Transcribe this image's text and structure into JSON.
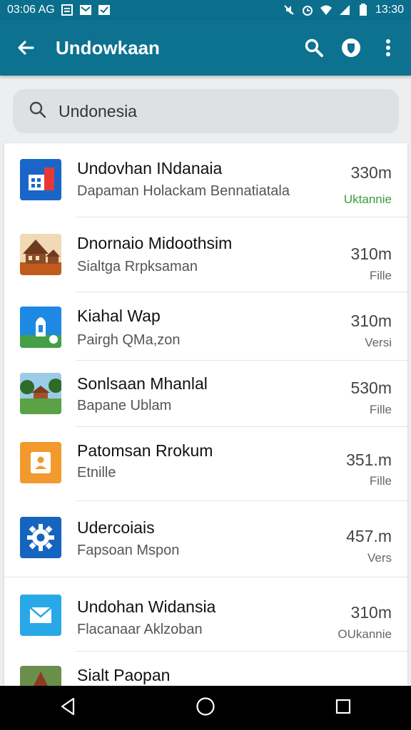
{
  "status_bar": {
    "left_text": "03:06 AG",
    "time": "13:30",
    "icons": [
      "image-icon",
      "mail-icon",
      "check-icon",
      "mute-icon",
      "alarm-icon",
      "wifi-icon",
      "signal-icon",
      "battery-icon"
    ]
  },
  "app_bar": {
    "title": "Undowkaan",
    "icons": [
      "back-arrow-icon",
      "search-icon",
      "shield-icon",
      "more-vert-icon"
    ]
  },
  "search": {
    "value": "Undonesia",
    "icon": "search-icon"
  },
  "list": [
    {
      "title": "Undovhan INdanaia",
      "subtitle": "Dapaman Holackam Bennatiatala",
      "size": "330m",
      "type": "Uktannie",
      "icon": "building-icon",
      "type_color": "#3b9b3b"
    },
    {
      "title": "Dnornaio Midoothsim",
      "subtitle": "Sialtga Rrpksaman",
      "size": "310m",
      "type": "Fille",
      "icon": "house-photo-icon",
      "type_color": "#666666"
    },
    {
      "title": "Kiahal Wap",
      "subtitle": "Pairgh QMa,zon",
      "size": "310m",
      "type": "Versi",
      "icon": "map-pin-icon",
      "type_color": "#666666"
    },
    {
      "title": "Sonlsaan Mhanlal",
      "subtitle": "Bapane Ublam",
      "size": "530m",
      "type": "Fille",
      "icon": "pavilion-photo-icon",
      "type_color": "#666666"
    },
    {
      "title": "Patomsan Rrokum",
      "subtitle": "Etnille",
      "size": "351.m",
      "type": "Fille",
      "icon": "contact-card-icon",
      "type_color": "#666666"
    },
    {
      "title": "Udercoiais",
      "subtitle": "Fapsoan Mspon",
      "size": "457.m",
      "type": "Vers",
      "icon": "gear-icon",
      "type_color": "#666666"
    },
    {
      "title": "Undohan Widansia",
      "subtitle": "Flacanaar Aklzoban",
      "size": "310m",
      "type": "OUkannie",
      "icon": "mail-icon",
      "type_color": "#666666"
    },
    {
      "title": "Sialt Paopan",
      "subtitle": "",
      "size": "",
      "type": "",
      "icon": "temple-photo-icon",
      "type_color": "#666666"
    }
  ],
  "nav_bar": {
    "icons": [
      "back-triangle-icon",
      "home-circle-icon",
      "recents-square-icon"
    ]
  },
  "colors": {
    "app_bar": "#0d7190",
    "status_bar": "#0b6e8c",
    "accent_green": "#3b9b3b"
  }
}
